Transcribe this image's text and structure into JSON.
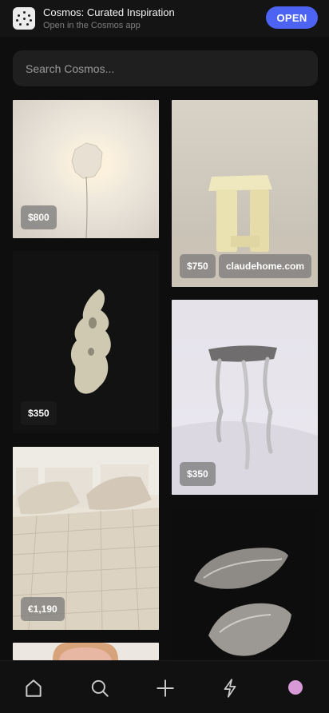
{
  "banner": {
    "title": "Cosmos: Curated Inspiration",
    "subtitle": "Open in the Cosmos app",
    "open_label": "OPEN",
    "accent_color": "#4d63f4",
    "icon": "cosmos-app-icon"
  },
  "search": {
    "placeholder": "Search Cosmos..."
  },
  "feed": {
    "items": [
      {
        "price": "$800",
        "source": "",
        "subject": "wall lamp"
      },
      {
        "price": "$750",
        "source": "claudehome.com",
        "subject": "sculptural side table"
      },
      {
        "price": "$350",
        "source": "",
        "subject": "ceramic sculpture"
      },
      {
        "price": "$350",
        "source": "",
        "subject": "metal stool"
      },
      {
        "price": "€1,190",
        "source": "",
        "subject": "quilted bed"
      },
      {
        "price": "",
        "source": "",
        "subject": "oyster dishes"
      },
      {
        "price": "",
        "source": "",
        "subject": "portrait"
      }
    ]
  },
  "nav": {
    "items": [
      "home-icon",
      "search-icon",
      "plus-icon",
      "lightning-icon",
      "avatar"
    ],
    "avatar_color": "#d89ad6"
  }
}
